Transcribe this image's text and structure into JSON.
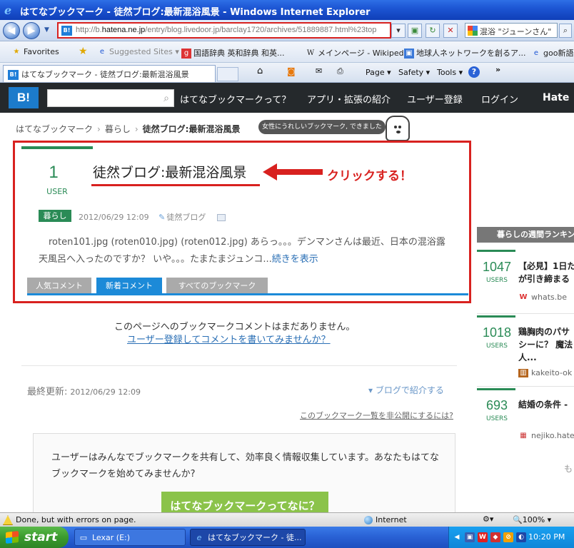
{
  "window": {
    "title": "はてなブックマーク - 徒然ブログ:最新混浴風景 - Windows Internet Explorer"
  },
  "address_bar": {
    "url_prefix": "http://b.",
    "url_domain": "hatena.ne.jp",
    "url_path": "/entry/blog.livedoor.jp/barclay1720/archives/51889887.html%23top",
    "search_text": "混浴 \"ジューンさん\""
  },
  "favorites_bar": {
    "favorites_label": "Favorites",
    "items": [
      "Suggested Sites ▾",
      "国語辞典 英和辞典 和英...",
      "メインページ - Wikipedia",
      "地球人ネットワークを創るア...",
      "goo新語"
    ]
  },
  "tabs": {
    "active_title": "はてなブックマーク - 徒然ブログ:最新混浴風景",
    "commands": [
      "Page ▾",
      "Safety ▾",
      "Tools ▾"
    ]
  },
  "hatena_header": {
    "logo": "B!",
    "nav": [
      "はてなブックマークって？",
      "アプリ・拡張の紹介",
      "ユーザー登録",
      "ログイン"
    ],
    "brand": "Hate"
  },
  "breadcrumb": {
    "items": [
      "はてなブックマーク",
      "暮らし",
      "徒然ブログ:最新混浴風景"
    ],
    "bubble": "女性にうれしいブックマーク, できました"
  },
  "entry": {
    "count": "1",
    "count_label": "USER",
    "title": "徒然ブログ:最新混浴風景",
    "annotation": "クリックする！",
    "category": "暮らし",
    "date": "2012/06/29 12:09",
    "source": "徒然ブログ",
    "snippet": "roten101.jpg (roten010.jpg) (roten012.jpg) あらっ。。。デンマンさんは最近、日本の混浴露天風呂へ入ったのですか？ いや。。。たまたまジュンコ...",
    "more_label": "続きを表示",
    "tabs": [
      "人気コメント",
      "新着コメント",
      "すべてのブックマーク"
    ]
  },
  "comments": {
    "none_message": "このページへのブックマークコメントはまだありません。",
    "register_link": "ユーザー登録してコメントを書いてみませんか？"
  },
  "footer_meta": {
    "updated_label": "最終更新:",
    "updated_date": "2012/06/29 12:09",
    "blog_intro": "▾ ブログで紹介する",
    "private_link": "このブックマーク一覧を非公開にするには?"
  },
  "promo": {
    "text": "ユーザーはみんなでブックマークを共有して、効率良く情報収集しています。あなたもはてなブックマークを始めてみませんか?",
    "button": "はてなブックマークってなに？"
  },
  "sidebar": {
    "header": "暮らしの週間ランキング",
    "items": [
      {
        "count": "1047",
        "users": "USERS",
        "title_line1": "【必見】1日た",
        "title_line2": "が引き締まる",
        "source": "whats.be"
      },
      {
        "count": "1018",
        "users": "USERS",
        "title_line1": "鶏胸肉のパサ",
        "title_line2": "シーに？ 魔法",
        "title_line3": "人...",
        "source": "kakeito-ok"
      },
      {
        "count": "693",
        "users": "USERS",
        "title_line1": "結婚の条件 -",
        "source": "nejiko.hate"
      }
    ],
    "more": "も"
  },
  "status_bar": {
    "message": "Done, but with errors on page.",
    "zone": "Internet",
    "zoom": "100% ▾"
  },
  "taskbar": {
    "start": "start",
    "tasks": [
      "Lexar (E:)",
      "はてなブックマーク - 徒..."
    ],
    "clock": "10:20 PM"
  }
}
